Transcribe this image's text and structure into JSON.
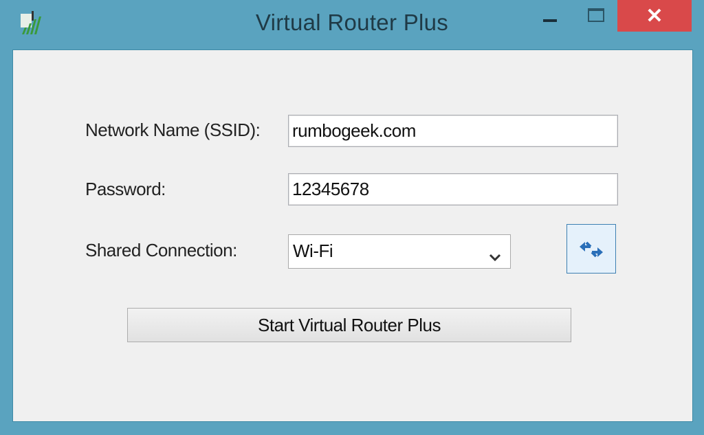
{
  "window": {
    "title": "Virtual Router Plus",
    "app_icon": "wifi-signal-icon",
    "controls": {
      "minimize": "minimize-icon",
      "maximize": "maximize-icon",
      "close": "✕"
    }
  },
  "form": {
    "ssid_label": "Network Name (SSID):",
    "ssid_value": "rumbogeek.com",
    "password_label": "Password:",
    "password_value": "12345678",
    "shared_label": "Shared Connection:",
    "shared_value": "Wi-Fi",
    "refresh_icon": "refresh-arrows-icon",
    "start_label": "Start Virtual Router Plus"
  },
  "colors": {
    "titlebar": "#5aa3bf",
    "close": "#d9494a",
    "client_bg": "#f0f0f0"
  }
}
